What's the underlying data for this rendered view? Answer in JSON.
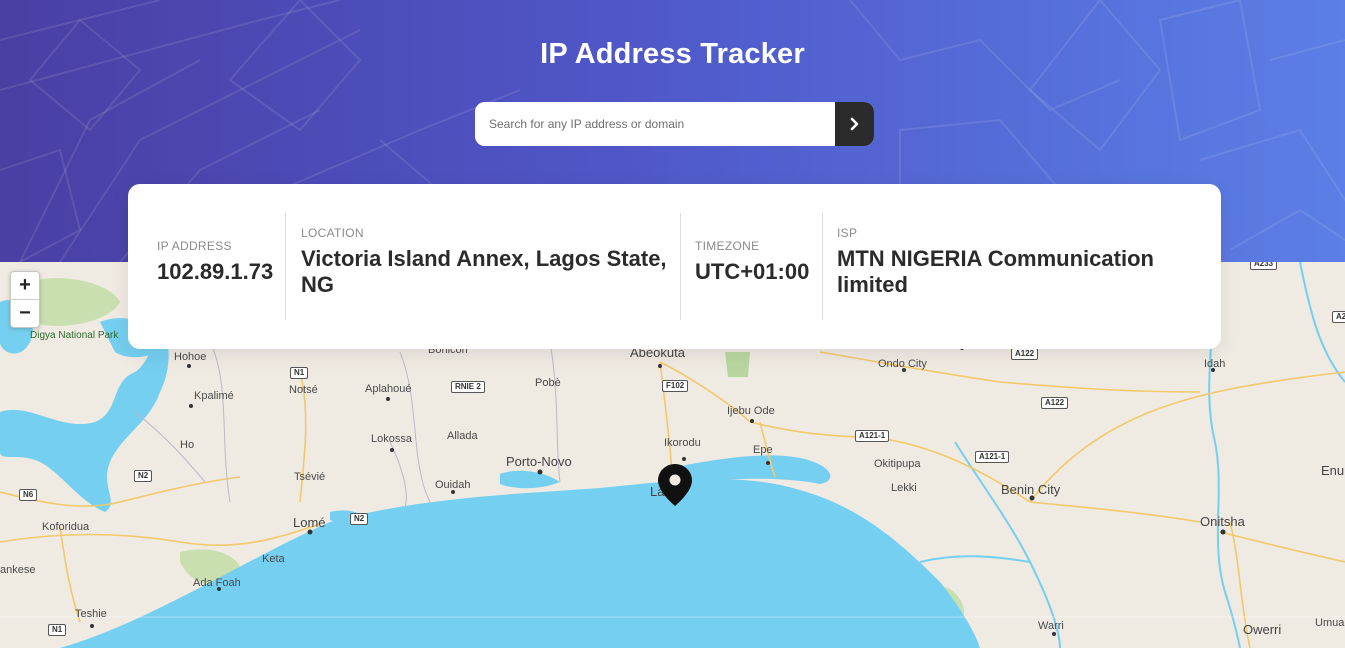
{
  "header": {
    "title": "IP Address Tracker"
  },
  "search": {
    "placeholder": "Search for any IP address or domain",
    "value": "",
    "button_icon": "chevron-right-icon"
  },
  "info": {
    "ip_address": {
      "label": "IP ADDRESS",
      "value": "102.89.1.73"
    },
    "location": {
      "label": "LOCATION",
      "value": "Victoria Island Annex, Lagos State, NG"
    },
    "timezone": {
      "label": "TIMEZONE",
      "value": "UTC+01:00"
    },
    "isp": {
      "label": "ISP",
      "value": "MTN NIGERIA Communication limited"
    }
  },
  "map": {
    "zoom_in": "+",
    "zoom_out": "−",
    "marker_icon": "location-pin-icon",
    "places": {
      "digya": "Digya National Park",
      "hohoe": "Hohoe",
      "kpalime": "Kpalimé",
      "ho": "Ho",
      "koforidua": "Koforidua",
      "nkawkaw": "ankese",
      "tema": "Teshie",
      "ada": "Ada Foah",
      "keta": "Keta",
      "lome": "Lomé",
      "tsevie": "Tsévié",
      "notse": "Notsé",
      "aplahoue": "Aplahoué",
      "lokossa": "Lokossa",
      "allada": "Allada",
      "ouidah": "Ouidah",
      "bohicon": "Bohicon",
      "pobe": "Pobè",
      "porto_novo": "Porto-Novo",
      "abeokuta": "Abeokuta",
      "ijebu_ode": "Ijebu Ode",
      "ikorodu": "Ikorodu",
      "epe": "Epe",
      "lagos": "La",
      "ondo": "Ondo City",
      "okitipupa": "Okitipupa",
      "lekki": "Lekki",
      "benin": "Benin City",
      "onitsha": "Onitsha",
      "idah": "Idah",
      "enugu": "Enu",
      "warri": "Warri",
      "owerri": "Owerri",
      "umua": "Umua"
    },
    "roads": {
      "n1a": "N1",
      "n1b": "N1",
      "n2a": "N2",
      "n2b": "N2",
      "n6": "N6",
      "rnie2": "RNIE 2",
      "f102": "F102",
      "a122a": "A122",
      "a122b": "A122",
      "a121a": "A121-1",
      "a121b": "A121-1",
      "a2": "A2",
      "a233": "A233"
    }
  },
  "colors": {
    "header_start": "#4a3fa3",
    "header_end": "#5b7fe6",
    "water": "#75cff0",
    "land": "#efeae2",
    "card_text": "#2b2b2b",
    "label_text": "#8a8a8a"
  }
}
